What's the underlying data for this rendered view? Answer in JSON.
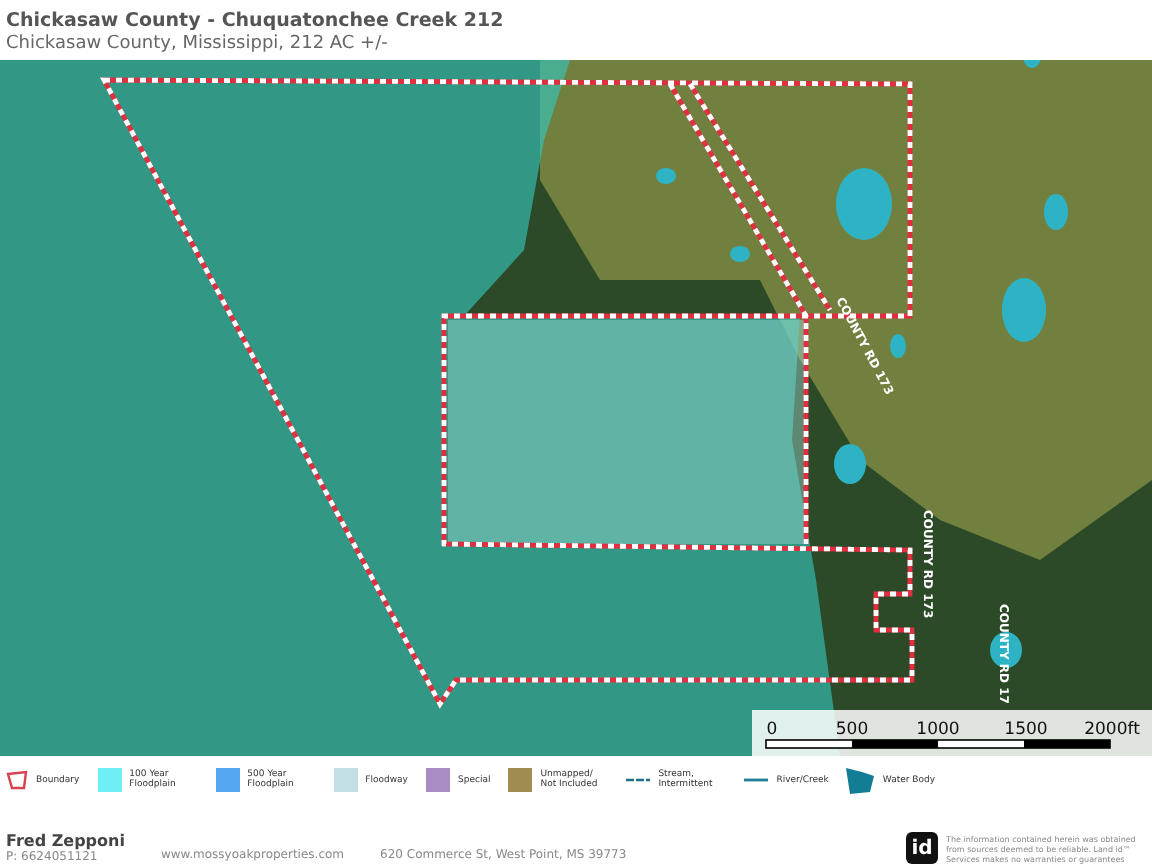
{
  "header": {
    "title": "Chickasaw County - Chuquatonchee Creek 212",
    "subtitle": "Chickasaw County, Mississippi, 212 AC +/-"
  },
  "map": {
    "road_labels": [
      "COUNTY RD 173",
      "COUNTY RD 173",
      "COUNTY RD 17"
    ],
    "scale_labels": [
      "0",
      "500",
      "1000",
      "1500",
      "2000ft"
    ]
  },
  "legend": [
    {
      "label": "Boundary",
      "kind": "boundary",
      "color": "#d94050"
    },
    {
      "label": "100 Year Floodplain",
      "kind": "swatch",
      "color": "#70eef5"
    },
    {
      "label": "500 Year Floodplain",
      "kind": "swatch",
      "color": "#55a6f0"
    },
    {
      "label": "Floodway",
      "kind": "swatch",
      "color": "#c3dfe6"
    },
    {
      "label": "Special",
      "kind": "swatch",
      "color": "#a98cc6"
    },
    {
      "label": "Unmapped/ Not Included",
      "kind": "swatch",
      "color": "#a08c50"
    },
    {
      "label": "Stream, Intermittent",
      "kind": "dash",
      "color": "#1f6f8a"
    },
    {
      "label": "River/Creek",
      "kind": "line",
      "color": "#1f7f9a"
    },
    {
      "label": "Water Body",
      "kind": "water",
      "color": "#147d96"
    }
  ],
  "footer": {
    "agent": "Fred Zepponi",
    "phone": "P: 6624051121",
    "website": "www.mossyoakproperties.com",
    "address": "620 Commerce St, West Point, MS 39773",
    "logo": "id",
    "disclaimer": "The information contained herein was obtained from sources deemed to be reliable. Land id™ Services makes no warranties or guarantees"
  }
}
